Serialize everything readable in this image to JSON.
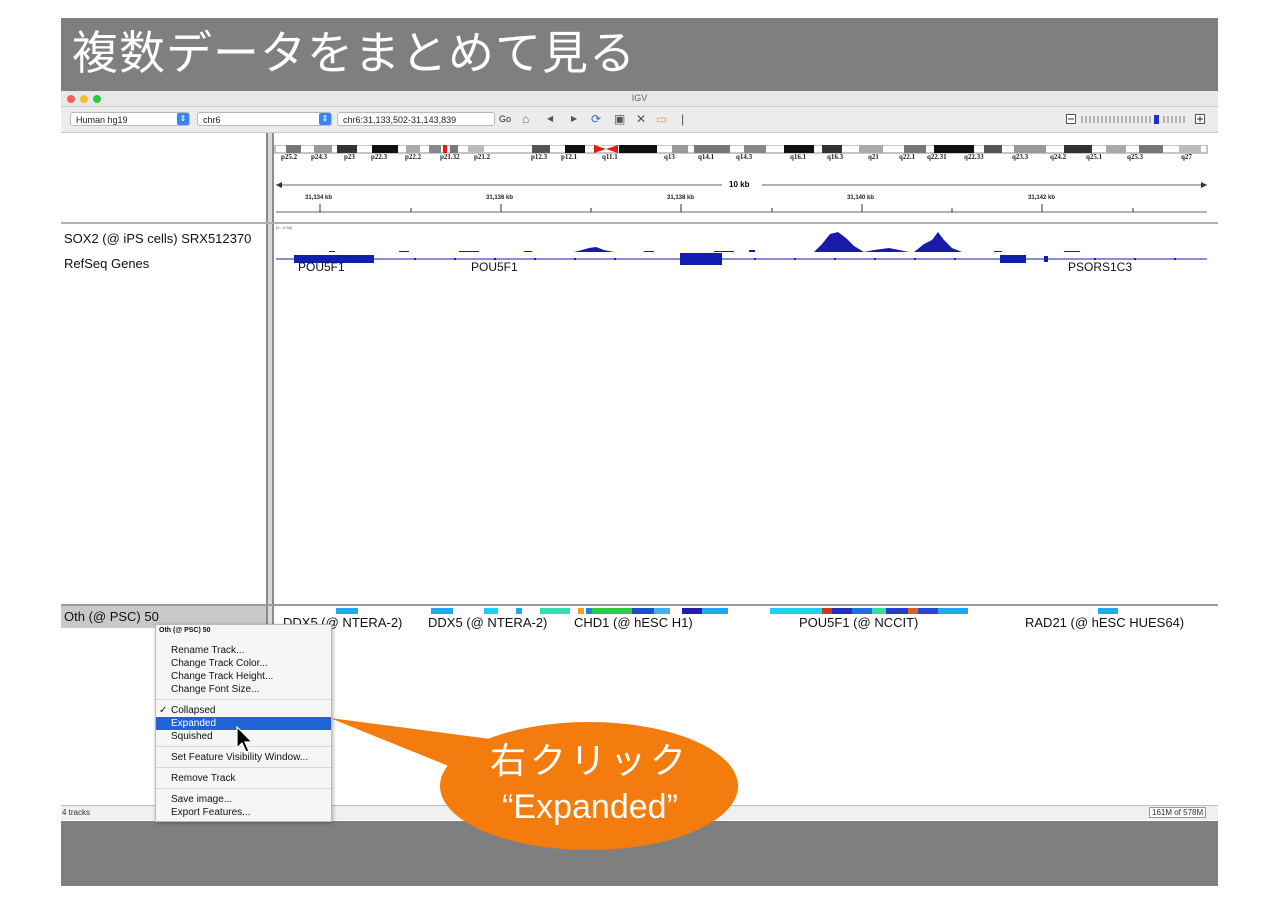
{
  "slide": {
    "title": "複数データをまとめて見る"
  },
  "window": {
    "title": "IGV"
  },
  "toolbar": {
    "genome": "Human hg19",
    "chromosome": "chr6",
    "locus": "chr6:31,133,502-31,143,839",
    "go_label": "Go"
  },
  "ruler": {
    "cytobands": [
      "p25.2",
      "p24.3",
      "p23",
      "p22.3",
      "p22.2",
      "p21.32",
      "p21.2",
      "p12.3",
      "p12.1",
      "q11.1",
      "q13",
      "q14.1",
      "q14.3",
      "q16.1",
      "q16.3",
      "q21",
      "q22.1",
      "q22.31",
      "q22.33",
      "q23.3",
      "q24.2",
      "q25.1",
      "q25.3",
      "q27"
    ],
    "span_label": "10 kb",
    "ticks": [
      "31,134 kb",
      "31,136 kb",
      "31,138 kb",
      "31,140 kb",
      "31,142 kb"
    ]
  },
  "upper_panel": {
    "tracks": [
      "SOX2 (@ iPS cells) SRX512370",
      "RefSeq Genes"
    ],
    "data_range": "[0 - 4.38]",
    "genes": [
      "POU5F1",
      "POU5F1",
      "PSORS1C3"
    ]
  },
  "lower_panel": {
    "track_name": "Oth (@ PSC) 50",
    "features": [
      "DDX5 (@ NTERA-2)",
      "DDX5 (@ NTERA-2)",
      "CHD1 (@ hESC H1)",
      "POU5F1 (@ NCCIT)",
      "RAD21 (@ hESC HUES64)"
    ]
  },
  "context_menu": {
    "header": "Oth (@ PSC) 50",
    "items": [
      "Rename Track...",
      "Change Track Color...",
      "Change Track Height...",
      "Change Font Size..."
    ],
    "modes": [
      "Collapsed",
      "Expanded",
      "Squished"
    ],
    "checked_mark": "✓",
    "visibility": "Set Feature Visibility Window...",
    "remove": "Remove Track",
    "export_items": [
      "Save image...",
      "Export Features..."
    ]
  },
  "status": {
    "tracks": "4 tracks",
    "memory": "161M of 578M"
  },
  "callout": {
    "line1": "右クリック",
    "line2": "“Expanded”",
    "color": "#f47b0d"
  },
  "colors": {
    "coverage": "#1a1aa8",
    "gene": "#0f1fb0",
    "highlight": "#1f63d6",
    "slide_bg": "#7f7f7f"
  }
}
